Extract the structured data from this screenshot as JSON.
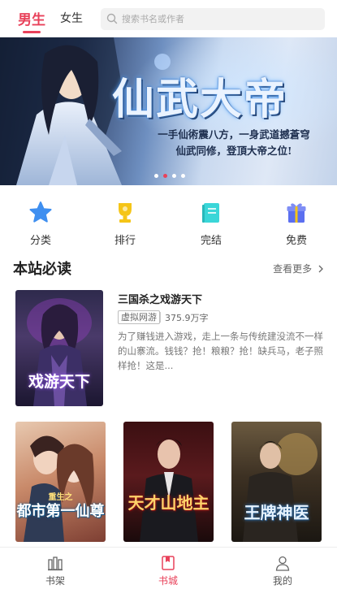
{
  "header": {
    "tabs": [
      "男生",
      "女生"
    ],
    "active_tab": "男生",
    "search_placeholder": "搜索书名或作者"
  },
  "banner": {
    "title": "仙武大帝",
    "tagline_line1": "一手仙術震八方，一身武道撼蒼穹",
    "tagline_line2": "仙武同修，登頂大帝之位!",
    "active_dot": 1,
    "dot_count": 4
  },
  "quick_nav": [
    {
      "label": "分类",
      "icon": "star-icon",
      "color": "#3f8ff0"
    },
    {
      "label": "排行",
      "icon": "trophy-icon",
      "color": "#f5c518"
    },
    {
      "label": "完结",
      "icon": "book-icon",
      "color": "#3ad6d8"
    },
    {
      "label": "免费",
      "icon": "gift-icon",
      "color": "#5b6ff0"
    }
  ],
  "section": {
    "title": "本站必读",
    "more_label": "查看更多"
  },
  "featured_book": {
    "title": "三国杀之戏游天下",
    "tag": "虚拟网游",
    "count": "375.9万字",
    "description": "为了赚钱进入游戏，走上一条与传统建没流不一样的山寨流。钱钱？抢！粮粮？抢！缺兵马，老子照样抢！这是...",
    "cover_text": "戏游天下"
  },
  "grid_books": [
    {
      "cover_text_top": "重生之",
      "cover_text": "都市第一仙尊"
    },
    {
      "cover_text": "天才山地主"
    },
    {
      "cover_text": "王牌神医"
    }
  ],
  "bottom_nav": [
    {
      "label": "书架",
      "icon": "bookshelf-icon"
    },
    {
      "label": "书城",
      "icon": "bookstore-icon"
    },
    {
      "label": "我的",
      "icon": "profile-icon"
    }
  ],
  "active_bottom": "书城",
  "colors": {
    "accent": "#e8415a"
  }
}
